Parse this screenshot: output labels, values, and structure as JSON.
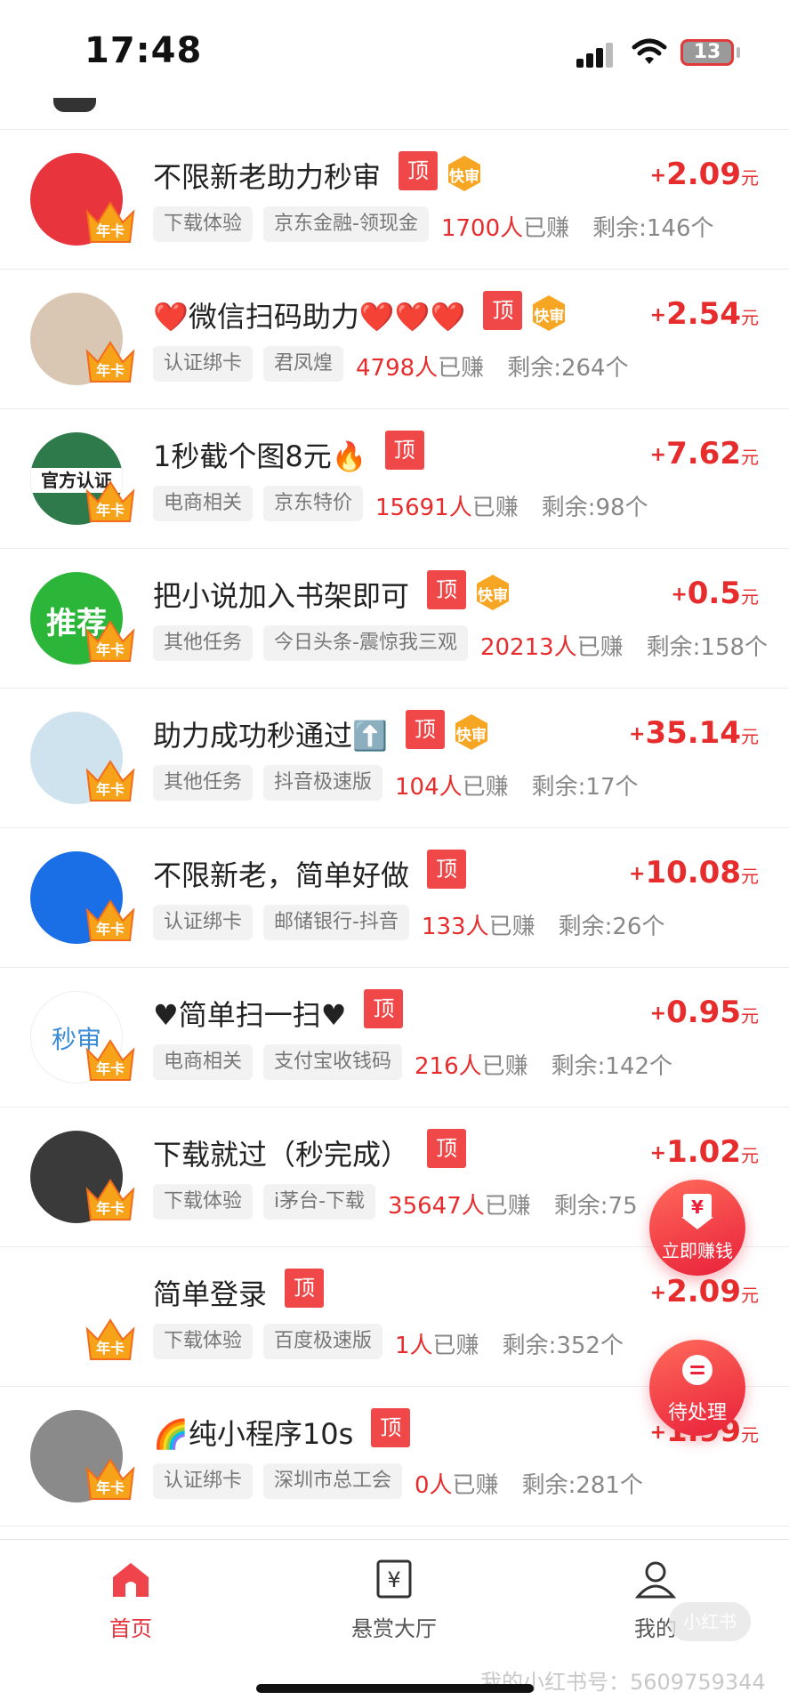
{
  "status_bar": {
    "time": "17:48",
    "battery": "13"
  },
  "tasks": [
    {
      "title": "不限新老助力秒审",
      "top_label": "顶",
      "fast": true,
      "fast_label": "快审",
      "reward": "2.09",
      "reward_prefix": "+",
      "reward_unit": "元",
      "tags": [
        "下载体验",
        "京东金融-领现金"
      ],
      "count": "1700人",
      "earned_label": "已赚",
      "remaining": "剩余:146个",
      "avatar_text": "",
      "crown_label": "年卡"
    },
    {
      "title": "❤️微信扫码助力❤️❤️❤️",
      "top_label": "顶",
      "fast": true,
      "fast_label": "快审",
      "reward": "2.54",
      "reward_prefix": "+",
      "reward_unit": "元",
      "tags": [
        "认证绑卡",
        "君凤煌"
      ],
      "count": "4798人",
      "earned_label": "已赚",
      "remaining": "剩余:264个",
      "avatar_text": "",
      "crown_label": "年卡"
    },
    {
      "title": "1秒截个图8元🔥",
      "top_label": "顶",
      "fast": false,
      "fast_label": "",
      "reward": "7.62",
      "reward_prefix": "+",
      "reward_unit": "元",
      "tags": [
        "电商相关",
        "京东特价"
      ],
      "count": "15691人",
      "earned_label": "已赚",
      "remaining": "剩余:98个",
      "avatar_text": "官方认证",
      "crown_label": "年卡"
    },
    {
      "title": "把小说加入书架即可",
      "top_label": "顶",
      "fast": true,
      "fast_label": "快审",
      "reward": "0.5",
      "reward_prefix": "+",
      "reward_unit": "元",
      "tags": [
        "其他任务",
        "今日头条-震惊我三观"
      ],
      "count": "20213人",
      "earned_label": "已赚",
      "remaining": "剩余:158个",
      "avatar_text": "推荐",
      "crown_label": "年卡"
    },
    {
      "title": "助力成功秒通过⬆️",
      "top_label": "顶",
      "fast": true,
      "fast_label": "快审",
      "reward": "35.14",
      "reward_prefix": "+",
      "reward_unit": "元",
      "tags": [
        "其他任务",
        "抖音极速版"
      ],
      "count": "104人",
      "earned_label": "已赚",
      "remaining": "剩余:17个",
      "avatar_text": "",
      "crown_label": "年卡"
    },
    {
      "title": "不限新老，简单好做",
      "top_label": "顶",
      "fast": false,
      "fast_label": "",
      "reward": "10.08",
      "reward_prefix": "+",
      "reward_unit": "元",
      "tags": [
        "认证绑卡",
        "邮储银行-抖音"
      ],
      "count": "133人",
      "earned_label": "已赚",
      "remaining": "剩余:26个",
      "avatar_text": "",
      "crown_label": "年卡"
    },
    {
      "title": "♥简单扫一扫♥",
      "top_label": "顶",
      "fast": false,
      "fast_label": "",
      "reward": "0.95",
      "reward_prefix": "+",
      "reward_unit": "元",
      "tags": [
        "电商相关",
        "支付宝收钱码"
      ],
      "count": "216人",
      "earned_label": "已赚",
      "remaining": "剩余:142个",
      "avatar_text": "秒审",
      "crown_label": "年卡"
    },
    {
      "title": "下载就过（秒完成）",
      "top_label": "顶",
      "fast": false,
      "fast_label": "",
      "reward": "1.02",
      "reward_prefix": "+",
      "reward_unit": "元",
      "tags": [
        "下载体验",
        "i茅台-下载"
      ],
      "count": "35647人",
      "earned_label": "已赚",
      "remaining": "剩余:75",
      "avatar_text": "",
      "crown_label": "年卡"
    },
    {
      "title": "简单登录",
      "top_label": "顶",
      "fast": false,
      "fast_label": "",
      "reward": "2.09",
      "reward_prefix": "+",
      "reward_unit": "元",
      "tags": [
        "下载体验",
        "百度极速版"
      ],
      "count": "1人",
      "earned_label": "已赚",
      "remaining": "剩余:352个",
      "avatar_text": "",
      "crown_label": "年卡"
    },
    {
      "title": "🌈纯小程序10s",
      "top_label": "顶",
      "fast": false,
      "fast_label": "",
      "reward": "1.99",
      "reward_prefix": "+",
      "reward_unit": "元",
      "tags": [
        "认证绑卡",
        "深圳市总工会"
      ],
      "count": "0人",
      "earned_label": "已赚",
      "remaining": "剩余:281个",
      "avatar_text": "",
      "crown_label": "年卡"
    }
  ],
  "fab_earn": {
    "label": "立即赚钱",
    "icon": "yen-download-icon"
  },
  "fab_pending": {
    "label": "待处理",
    "icon": "chat-bubble-icon"
  },
  "nav": {
    "items": [
      {
        "label": "首页",
        "icon": "home-icon",
        "active": true
      },
      {
        "label": "悬赏大厅",
        "icon": "yen-board-icon",
        "active": false
      },
      {
        "label": "我的",
        "icon": "user-icon",
        "active": false
      }
    ]
  },
  "watermark": {
    "text": "我的小红书号：5609759344",
    "badge": "小红书"
  },
  "colors": {
    "accent": "#e62c2c",
    "badge": "#f04848",
    "fast_badge": "#f6a623",
    "crown": "#f7a31a"
  }
}
